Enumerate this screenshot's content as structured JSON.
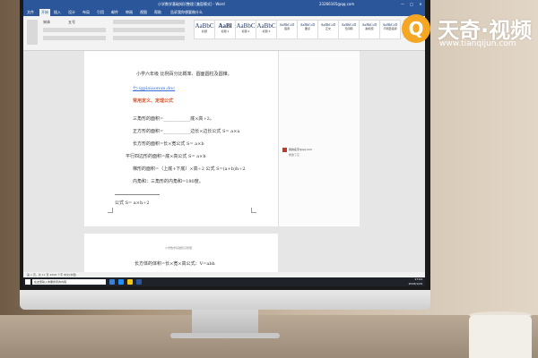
{
  "watermark": {
    "name": "天奇·视频",
    "url": "www.tianqijun.com",
    "badge_icon": "Q"
  },
  "window": {
    "title": "小学数学基础知识整理 [兼容模式] - Word",
    "user": "23266165@qq.com",
    "controls": [
      "—",
      "□",
      "✕"
    ]
  },
  "ribbon": {
    "tabs": [
      "文件",
      "开始",
      "插入",
      "设计",
      "布局",
      "引用",
      "邮件",
      "审阅",
      "视图",
      "帮助",
      "告诉我你想要做什么"
    ],
    "styles": [
      {
        "preview": "AaBbC",
        "label": "标题"
      },
      {
        "preview": "AaBl",
        "label": "标题 1"
      },
      {
        "preview": "AaBbC",
        "label": "标题 2"
      },
      {
        "preview": "AaBbC",
        "label": "标题 3"
      },
      {
        "preview": "AaBbCcD",
        "label": "强调"
      },
      {
        "preview": "AaBbCcD",
        "label": "要点"
      },
      {
        "preview": "AaBbCcD",
        "label": "正文"
      },
      {
        "preview": "AaBbCcD",
        "label": "无间隔"
      },
      {
        "preview": "AaBbCcD",
        "label": "副标题"
      },
      {
        "preview": "AaBbCcD",
        "label": "不明显强调"
      }
    ],
    "font_name": "宋体",
    "font_size": "五号"
  },
  "document": {
    "lines": [
      {
        "text": "小学六年级  比例百分比概率、圆面圆柱及圆锥。",
        "style": "normal"
      },
      {
        "text": "七·/gplaiaonun.doc",
        "style": "link"
      },
      {
        "text": "常用定义、定理公式",
        "style": "red"
      },
      {
        "text": "三角形的面积=____________底×高÷2。",
        "style": "normal"
      },
      {
        "text": "正方形的面积=____________边长×边长公式 S= a×a",
        "style": "normal"
      },
      {
        "text": "长方形的面积=长×宽公式 S= a×b",
        "style": "normal"
      },
      {
        "text": "平行四边形的面积=底×高公式 S= a×h",
        "style": "normal"
      },
      {
        "text": "梯形的面积=（上底+下底）×高÷2 公式 S=(a+b)h÷2",
        "style": "normal"
      },
      {
        "text": "内角和：三角形的内角和=180度。",
        "style": "normal"
      },
      {
        "text": "公式 S= a×h÷2",
        "style": "normal"
      }
    ],
    "page2_header": "小学数学基础知识整理",
    "page2_line": "长方体的体积=长×宽×高公式：V=abh"
  },
  "comment": {
    "author": "我的名字@qq.com",
    "text": "修改了它"
  },
  "statusbar": {
    "text": "第 1 页，共 11 页    2008 个字    中文(中国)"
  },
  "taskbar": {
    "search_placeholder": "在这里输入你要搜索的内容",
    "time": "17:04",
    "date": "2018/1/29"
  },
  "colors": {
    "word_blue": "#2b579a",
    "link": "#3a6fd8",
    "accent_red": "#d9542b",
    "logo_orange": "#f5a623"
  }
}
